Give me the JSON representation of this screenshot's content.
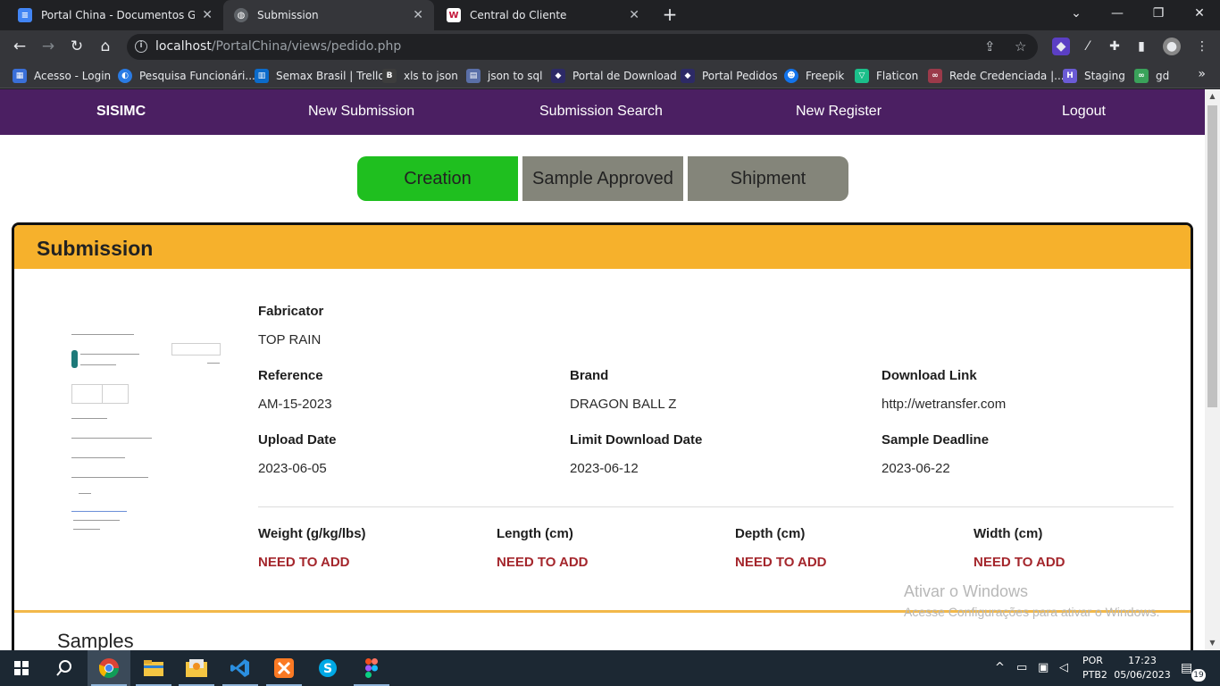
{
  "browser": {
    "tabs": [
      {
        "title": "Portal China - Documentos Goog",
        "favicon_color": "#4285f4",
        "favicon_glyph": "≡"
      },
      {
        "title": "Submission",
        "favicon_color": "#5f6368",
        "favicon_glyph": "◍"
      },
      {
        "title": "Central do Cliente",
        "favicon_color": "#c4163a",
        "favicon_glyph": "W"
      }
    ],
    "url_host": "localhost",
    "url_path": "/PortalChina/views/pedido.php",
    "bookmarks": [
      {
        "label": "Acesso - Login",
        "color": "#3a6fd8",
        "glyph": "▦"
      },
      {
        "label": "Pesquisa Funcionári...",
        "color": "#2a7be4",
        "glyph": "◐"
      },
      {
        "label": "Semax Brasil | Trello",
        "color": "#0b6bcb",
        "glyph": "▥"
      },
      {
        "label": "xls to json",
        "color": "#3d3d3d",
        "glyph": "B"
      },
      {
        "label": "json to sql",
        "color": "#5a6fa8",
        "glyph": "▤"
      },
      {
        "label": "Portal de Download",
        "color": "#2d2a66",
        "glyph": "◆"
      },
      {
        "label": "Portal Pedidos",
        "color": "#2d2a66",
        "glyph": "◆"
      },
      {
        "label": "Freepik",
        "color": "#1273eb",
        "glyph": "☻"
      },
      {
        "label": "Flaticon",
        "color": "#1bbf8a",
        "glyph": "▽"
      },
      {
        "label": "Rede Credenciada |...",
        "color": "#9b3a4a",
        "glyph": "∞"
      },
      {
        "label": "Staging",
        "color": "#6b5bd6",
        "glyph": "H"
      },
      {
        "label": "gd",
        "color": "#3aa25a",
        "glyph": "∞"
      }
    ]
  },
  "nav": {
    "brand": "SISIMC",
    "new_submission": "New Submission",
    "submission_search": "Submission Search",
    "new_register": "New Register",
    "logout": "Logout"
  },
  "steps": {
    "creation": "Creation",
    "sample_approved": "Sample Approved",
    "shipment": "Shipment",
    "active_color": "#1fbf1f",
    "inactive_color": "#84857a"
  },
  "submission": {
    "title": "Submission",
    "header_color": "#f6b12c",
    "fabricator_label": "Fabricator",
    "fabricator": "TOP RAIN",
    "reference_label": "Reference",
    "reference": "AM-15-2023",
    "brand_label": "Brand",
    "brand": "DRAGON BALL Z",
    "download_link_label": "Download Link",
    "download_link": "http://wetransfer.com",
    "upload_date_label": "Upload Date",
    "upload_date": "2023-06-05",
    "limit_download_label": "Limit Download Date",
    "limit_download": "2023-06-12",
    "sample_deadline_label": "Sample Deadline",
    "sample_deadline": "2023-06-22",
    "weight_label": "Weight (g/kg/lbs)",
    "weight": "NEED TO ADD",
    "length_label": "Length (cm)",
    "length": "NEED TO ADD",
    "depth_label": "Depth (cm)",
    "depth": "NEED TO ADD",
    "width_label": "Width (cm)",
    "width": "NEED TO ADD",
    "missing_color": "#a4262c"
  },
  "samples": {
    "title": "Samples"
  },
  "watermark": {
    "line1": "Ativar o Windows",
    "line2": "Acesse Configurações para ativar o Windows."
  },
  "taskbar": {
    "lang1": "POR",
    "lang2": "PTB2",
    "time": "17:23",
    "date": "05/06/2023",
    "notifications": "19"
  }
}
